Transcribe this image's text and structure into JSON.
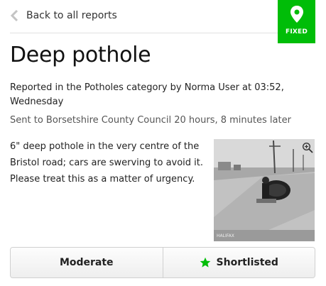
{
  "nav": {
    "back_label": "Back to all reports"
  },
  "status": {
    "label": "FIXED",
    "color": "#00bd08"
  },
  "report": {
    "title": "Deep pothole",
    "meta": "Reported in the Potholes category by Norma User at 03:52, Wednesday",
    "sent": "Sent to Borsetshire County Council 20 hours, 8 minutes later",
    "description": "6\" deep pothole in the very centre of the Bristol road; cars are swerving to avoid it. Please treat this as a matter of urgency."
  },
  "photo": {
    "watermark": "HALIFAX"
  },
  "actions": {
    "moderate_label": "Moderate",
    "shortlist_label": "Shortlisted",
    "shortlist_icon_color": "#00bd08"
  },
  "icons": {
    "back": "chevron-left-icon",
    "status": "map-pin-icon",
    "zoom": "zoom-in-icon",
    "shortlist": "star-icon"
  }
}
